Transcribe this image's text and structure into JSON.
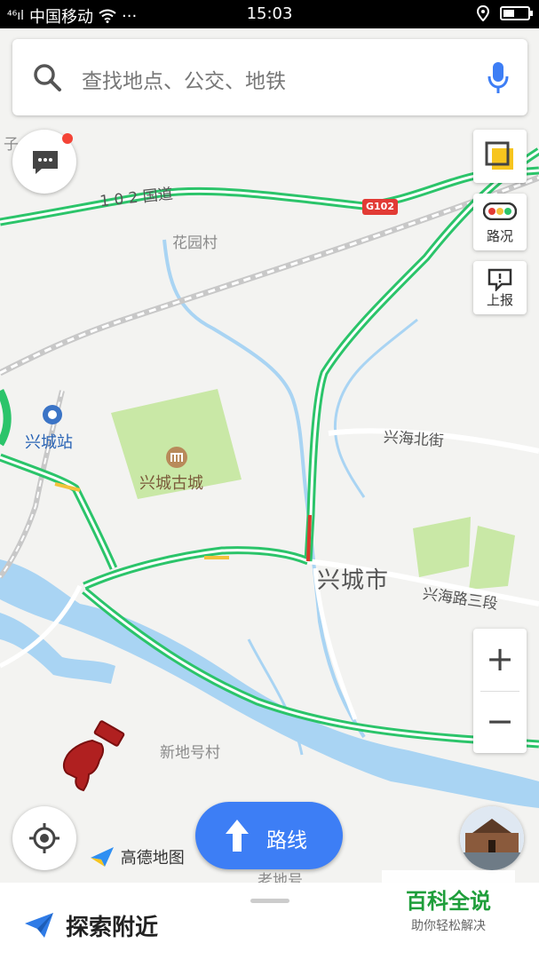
{
  "status_bar": {
    "signal": "⁴⁶ıl",
    "carrier": "中国移动",
    "dots": "···",
    "time": "15:03"
  },
  "search": {
    "placeholder": "查找地点、公交、地铁"
  },
  "map": {
    "labels": {
      "zi": "子",
      "road_102": "1 0 2 国道",
      "g102": "G102",
      "huayuan": "花园村",
      "station": "兴城站",
      "ancient_city": "兴城古城",
      "xinghai_north": "兴海北街",
      "city": "兴城市",
      "xinghai_road3": "兴海路三段",
      "xindihao": "新地号村",
      "laodihao": "老地号"
    }
  },
  "controls": {
    "traffic_label": "路况",
    "report_label": "上报",
    "zoom_in": "+",
    "zoom_out": "−",
    "route_label": "路线",
    "logo_text": "高德地图"
  },
  "bottom": {
    "title": "探索附近"
  },
  "watermark": {
    "line1": "百科全说",
    "line2": "助你轻松解决"
  },
  "colors": {
    "accent": "#3d7ef5",
    "road_green": "#2bc46a",
    "water": "#a9d4f3",
    "park": "#c9e8a6"
  }
}
